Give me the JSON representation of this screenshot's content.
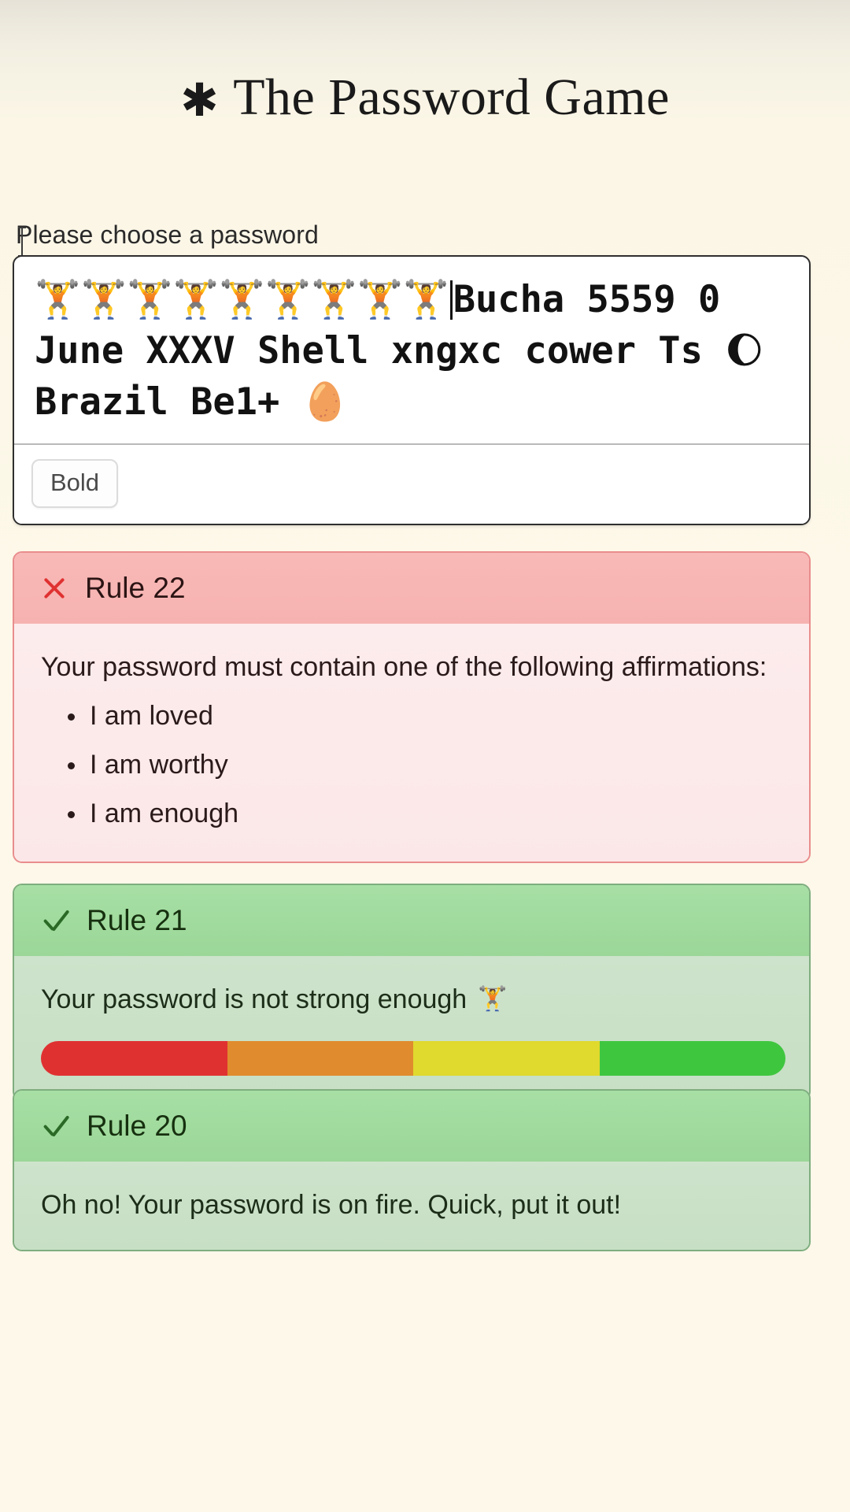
{
  "app": {
    "title": "The Password Game",
    "asterisk": "✱"
  },
  "password_form": {
    "label": "Please choose a password",
    "value_line1_emojis": "🏋️🏋️🏋️🏋️🏋️🏋️🏋️🏋️🏋️",
    "value_line1_text": "Bucha",
    "value_line2": "5559 0 June XXXV Shell xngxc",
    "value_line3_a": "cower Ts ",
    "value_line3_moon": "🌔",
    "value_line3_b": " Brazil Be1+ ",
    "value_line3_egg": "🥚",
    "toolbar": {
      "bold_label": "Bold"
    }
  },
  "rules": [
    {
      "id": "rule-22",
      "status": "fail",
      "status_icon": "x-icon",
      "title": "Rule 22",
      "body": "Your password must contain one of the following affirmations:",
      "items": [
        "I am loved",
        "I am worthy",
        "I am enough"
      ]
    },
    {
      "id": "rule-21",
      "status": "pass",
      "status_icon": "check-icon",
      "title": "Rule 21",
      "body": "Your password is not strong enough",
      "body_emoji": "🏋️",
      "strength_meter": {
        "segments": [
          "#e03131",
          "#e08b2e",
          "#e0d92e",
          "#3fc63f"
        ],
        "filled": 4
      }
    },
    {
      "id": "rule-20",
      "status": "pass",
      "status_icon": "check-icon",
      "title": "Rule 20",
      "body": "Oh no! Your password is on fire. Quick, put it out!"
    }
  ],
  "colors": {
    "page_bg": "#fdf8e9",
    "fail_header": "#f6b2b0",
    "fail_body": "#fdeced",
    "pass_header": "#9bd798",
    "pass_body": "#cde3cb",
    "x_icon": "#e03131",
    "check_icon": "#2a6a26"
  }
}
